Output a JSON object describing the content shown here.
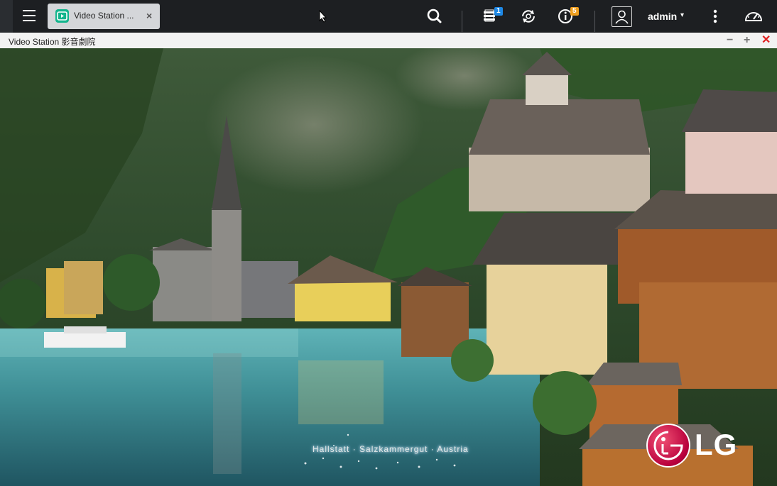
{
  "topbar": {
    "menu_icon": "hamburger-menu-icon",
    "tab": {
      "label": "Video Station ...",
      "close": "×",
      "icon": "video-station-icon",
      "accent": "#14b58d"
    },
    "icons": {
      "search": "search-icon",
      "tasks": "background-tasks-icon",
      "sync": "sync-icon",
      "notifications": "info-icon",
      "user": "user-avatar-icon",
      "more": "more-vertical-icon",
      "dashboard": "dashboard-gauge-icon"
    },
    "tasks_badge": "1",
    "notifications_badge": "5",
    "tasks_badge_color": "#1e88e5",
    "notifications_badge_color": "#f0a020",
    "user_name": "admin",
    "caret": "▾"
  },
  "window": {
    "title": "Video Station 影音劇院",
    "minimize": "−",
    "maximize": "+",
    "close": "✕",
    "close_color": "#e02020"
  },
  "content": {
    "caption": "Hallstatt · Salzkammergut · Austria",
    "brand_logo_text": "LG"
  }
}
